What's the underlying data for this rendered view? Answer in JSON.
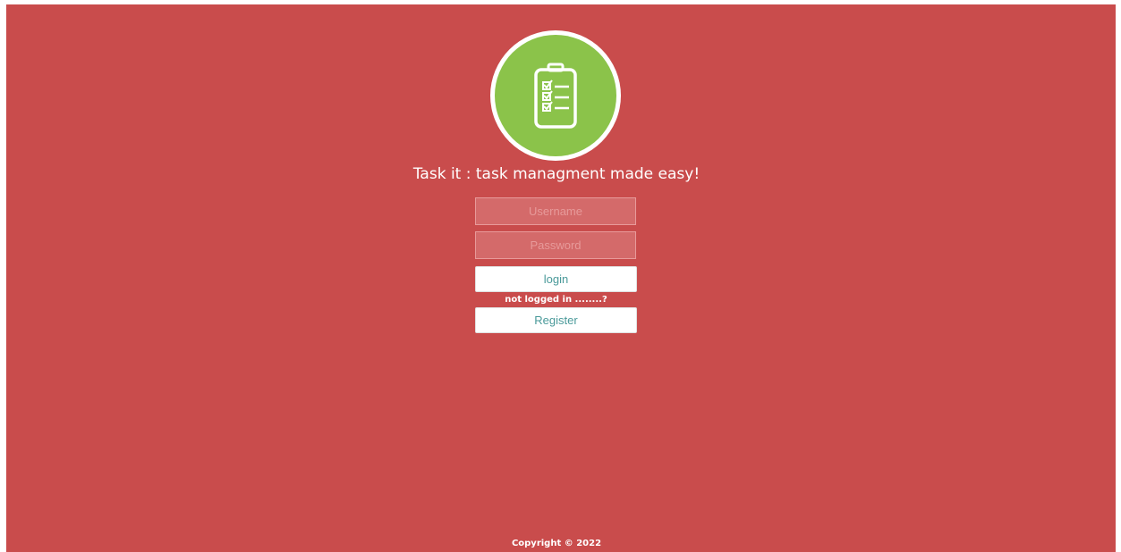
{
  "logo": {
    "icon": "clipboard-checklist-icon",
    "ring_color": "#ffffff",
    "fill_color": "#8bc34a"
  },
  "tagline": "Task it : task managment made easy!",
  "form": {
    "username_placeholder": "Username",
    "password_placeholder": "Password",
    "login_label": "login",
    "not_logged_text": "not logged in ........?",
    "register_label": "Register"
  },
  "footer": {
    "copyright": "Copyright © 2022"
  },
  "colors": {
    "background": "#c94c4c",
    "button_text": "#4a9a9a"
  }
}
